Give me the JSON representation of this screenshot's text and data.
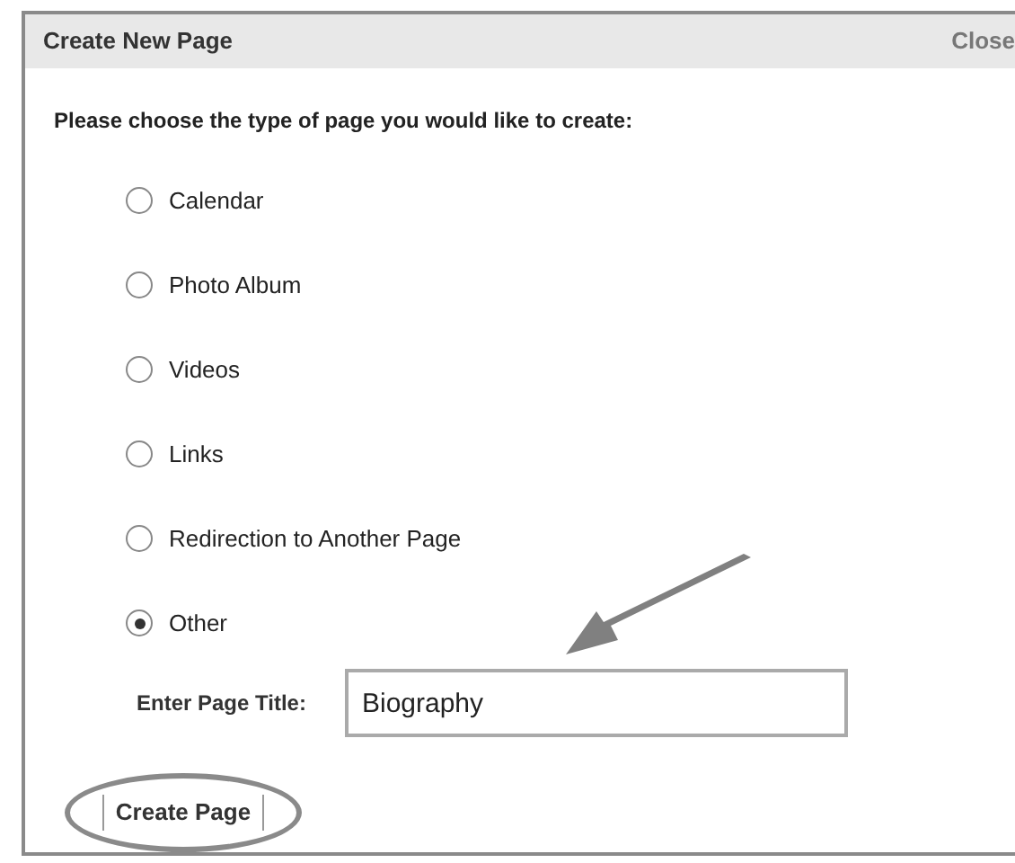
{
  "dialog": {
    "title": "Create New Page",
    "close": "Close"
  },
  "prompt": "Please choose the type of page you would like to create:",
  "options": [
    {
      "label": "Calendar",
      "selected": false
    },
    {
      "label": "Photo Album",
      "selected": false
    },
    {
      "label": "Videos",
      "selected": false
    },
    {
      "label": "Links",
      "selected": false
    },
    {
      "label": "Redirection to Another Page",
      "selected": false
    },
    {
      "label": "Other",
      "selected": true
    }
  ],
  "title_field": {
    "label": "Enter Page Title:",
    "value": "Biography"
  },
  "button": "Create Page"
}
